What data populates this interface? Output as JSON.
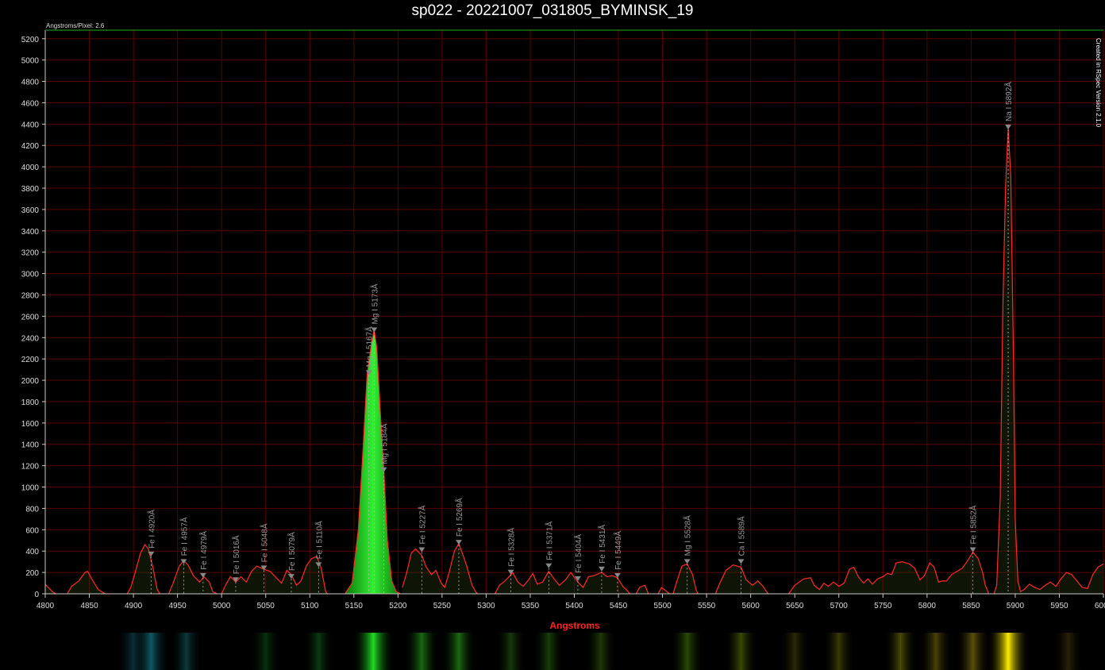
{
  "chart_data": {
    "type": "line",
    "title": "sp022 - 20221007_031805_BYMINSK_19",
    "xlabel": "Angstroms",
    "ylabel": "",
    "scale_note": "Angstroms/Pixel: 2.6",
    "credit": "Created in RSpec Version 2.1.0",
    "xlim": [
      4800,
      6000
    ],
    "ylim": [
      0,
      5280
    ],
    "x_ticks": [
      4800,
      4850,
      4900,
      4950,
      5000,
      5050,
      5100,
      5150,
      5200,
      5250,
      5300,
      5350,
      5400,
      5450,
      5500,
      5550,
      5600,
      5650,
      5700,
      5750,
      5800,
      5850,
      5900,
      5950,
      6000
    ],
    "y_ticks": [
      0,
      200,
      400,
      600,
      800,
      1000,
      1200,
      1400,
      1600,
      1800,
      2000,
      2200,
      2400,
      2600,
      2800,
      3000,
      3200,
      3400,
      3600,
      3800,
      4000,
      4200,
      4400,
      4600,
      4800,
      5000,
      5200
    ],
    "grid": true,
    "colors": {
      "line": "#ff2a2a",
      "grid": "#5a0000",
      "green_fill": "#22cc22",
      "yellow_fill": "#ffcc00",
      "marker": "#888888",
      "label": "#9a9a9a"
    },
    "series": [
      {
        "points": [
          [
            4800,
            90
          ],
          [
            4808,
            20
          ],
          [
            4812,
            -10
          ],
          [
            4825,
            -10
          ],
          [
            4830,
            70
          ],
          [
            4838,
            120
          ],
          [
            4845,
            200
          ],
          [
            4848,
            210
          ],
          [
            4852,
            150
          ],
          [
            4860,
            40
          ],
          [
            4868,
            -10
          ],
          [
            4893,
            -10
          ],
          [
            4897,
            60
          ],
          [
            4902,
            200
          ],
          [
            4908,
            380
          ],
          [
            4913,
            460
          ],
          [
            4917,
            420
          ],
          [
            4922,
            250
          ],
          [
            4927,
            40
          ],
          [
            4930,
            -10
          ],
          [
            4940,
            -10
          ],
          [
            4945,
            100
          ],
          [
            4952,
            260
          ],
          [
            4957,
            310
          ],
          [
            4962,
            270
          ],
          [
            4968,
            170
          ],
          [
            4975,
            110
          ],
          [
            4980,
            160
          ],
          [
            4986,
            110
          ],
          [
            4990,
            20
          ],
          [
            4995,
            -10
          ],
          [
            5000,
            -10
          ],
          [
            5005,
            90
          ],
          [
            5010,
            160
          ],
          [
            5016,
            110
          ],
          [
            5022,
            160
          ],
          [
            5028,
            110
          ],
          [
            5034,
            210
          ],
          [
            5040,
            260
          ],
          [
            5048,
            230
          ],
          [
            5055,
            210
          ],
          [
            5062,
            150
          ],
          [
            5068,
            100
          ],
          [
            5074,
            220
          ],
          [
            5079,
            180
          ],
          [
            5085,
            80
          ],
          [
            5090,
            120
          ],
          [
            5096,
            260
          ],
          [
            5102,
            330
          ],
          [
            5108,
            350
          ],
          [
            5113,
            240
          ],
          [
            5118,
            20
          ],
          [
            5120,
            -10
          ],
          [
            5140,
            -10
          ],
          [
            5148,
            100
          ],
          [
            5155,
            600
          ],
          [
            5160,
            1300
          ],
          [
            5165,
            2050
          ],
          [
            5170,
            2350
          ],
          [
            5173,
            2470
          ],
          [
            5176,
            2300
          ],
          [
            5180,
            1700
          ],
          [
            5184,
            1150
          ],
          [
            5188,
            500
          ],
          [
            5193,
            120
          ],
          [
            5198,
            20
          ],
          [
            5203,
            -10
          ],
          [
            5205,
            60
          ],
          [
            5210,
            200
          ],
          [
            5215,
            380
          ],
          [
            5220,
            420
          ],
          [
            5227,
            360
          ],
          [
            5232,
            250
          ],
          [
            5238,
            180
          ],
          [
            5243,
            220
          ],
          [
            5249,
            100
          ],
          [
            5253,
            60
          ],
          [
            5258,
            200
          ],
          [
            5264,
            400
          ],
          [
            5269,
            470
          ],
          [
            5273,
            380
          ],
          [
            5278,
            260
          ],
          [
            5284,
            80
          ],
          [
            5288,
            20
          ],
          [
            5290,
            -10
          ],
          [
            5310,
            -10
          ],
          [
            5315,
            80
          ],
          [
            5320,
            110
          ],
          [
            5326,
            160
          ],
          [
            5330,
            200
          ],
          [
            5336,
            110
          ],
          [
            5342,
            70
          ],
          [
            5348,
            130
          ],
          [
            5353,
            190
          ],
          [
            5358,
            90
          ],
          [
            5364,
            110
          ],
          [
            5371,
            210
          ],
          [
            5377,
            140
          ],
          [
            5383,
            80
          ],
          [
            5390,
            130
          ],
          [
            5396,
            200
          ],
          [
            5404,
            110
          ],
          [
            5410,
            60
          ],
          [
            5416,
            160
          ],
          [
            5422,
            170
          ],
          [
            5431,
            200
          ],
          [
            5437,
            160
          ],
          [
            5443,
            170
          ],
          [
            5449,
            150
          ],
          [
            5455,
            70
          ],
          [
            5460,
            30
          ],
          [
            5463,
            -10
          ],
          [
            5470,
            -10
          ],
          [
            5474,
            60
          ],
          [
            5480,
            80
          ],
          [
            5484,
            -10
          ],
          [
            5495,
            -10
          ],
          [
            5499,
            60
          ],
          [
            5505,
            20
          ],
          [
            5508,
            -10
          ],
          [
            5512,
            -10
          ],
          [
            5516,
            110
          ],
          [
            5522,
            260
          ],
          [
            5528,
            280
          ],
          [
            5534,
            180
          ],
          [
            5538,
            40
          ],
          [
            5540,
            -10
          ],
          [
            5560,
            -10
          ],
          [
            5565,
            100
          ],
          [
            5572,
            220
          ],
          [
            5580,
            270
          ],
          [
            5589,
            250
          ],
          [
            5595,
            130
          ],
          [
            5602,
            80
          ],
          [
            5608,
            120
          ],
          [
            5614,
            70
          ],
          [
            5618,
            20
          ],
          [
            5620,
            -10
          ],
          [
            5643,
            -10
          ],
          [
            5650,
            80
          ],
          [
            5660,
            140
          ],
          [
            5668,
            150
          ],
          [
            5672,
            80
          ],
          [
            5678,
            40
          ],
          [
            5683,
            100
          ],
          [
            5688,
            70
          ],
          [
            5694,
            110
          ],
          [
            5700,
            70
          ],
          [
            5706,
            100
          ],
          [
            5712,
            230
          ],
          [
            5717,
            250
          ],
          [
            5722,
            160
          ],
          [
            5728,
            100
          ],
          [
            5733,
            140
          ],
          [
            5738,
            90
          ],
          [
            5744,
            140
          ],
          [
            5750,
            160
          ],
          [
            5755,
            190
          ],
          [
            5760,
            180
          ],
          [
            5765,
            290
          ],
          [
            5772,
            300
          ],
          [
            5780,
            280
          ],
          [
            5786,
            240
          ],
          [
            5792,
            130
          ],
          [
            5797,
            170
          ],
          [
            5803,
            290
          ],
          [
            5808,
            250
          ],
          [
            5813,
            110
          ],
          [
            5817,
            120
          ],
          [
            5822,
            120
          ],
          [
            5828,
            180
          ],
          [
            5834,
            210
          ],
          [
            5840,
            240
          ],
          [
            5846,
            310
          ],
          [
            5852,
            390
          ],
          [
            5858,
            330
          ],
          [
            5863,
            200
          ],
          [
            5866,
            80
          ],
          [
            5870,
            -10
          ],
          [
            5876,
            -10
          ],
          [
            5879,
            80
          ],
          [
            5883,
            900
          ],
          [
            5886,
            2700
          ],
          [
            5889,
            3800
          ],
          [
            5892,
            4360
          ],
          [
            5895,
            3900
          ],
          [
            5898,
            2200
          ],
          [
            5900,
            700
          ],
          [
            5903,
            120
          ],
          [
            5906,
            20
          ],
          [
            5910,
            40
          ],
          [
            5916,
            90
          ],
          [
            5922,
            60
          ],
          [
            5928,
            40
          ],
          [
            5934,
            80
          ],
          [
            5940,
            110
          ],
          [
            5946,
            70
          ],
          [
            5952,
            140
          ],
          [
            5958,
            200
          ],
          [
            5964,
            180
          ],
          [
            5970,
            120
          ],
          [
            5976,
            60
          ],
          [
            5982,
            50
          ],
          [
            5988,
            180
          ],
          [
            5994,
            250
          ],
          [
            6000,
            280
          ]
        ]
      }
    ],
    "fill_bands": [
      {
        "from": 5140,
        "to": 5203,
        "color": "green"
      },
      {
        "from": 5876,
        "to": 5906,
        "color": "yellow"
      }
    ],
    "annotations": [
      {
        "x": 4920,
        "y": 350,
        "label": "Fe I 4920Å"
      },
      {
        "x": 4957,
        "y": 280,
        "label": "Fe I 4957Å"
      },
      {
        "x": 4979,
        "y": 150,
        "label": "Fe I 4979Å"
      },
      {
        "x": 5016,
        "y": 110,
        "label": "Fe I 5016Å"
      },
      {
        "x": 5048,
        "y": 220,
        "label": "Fe I 5048Å"
      },
      {
        "x": 5079,
        "y": 140,
        "label": "Fe I 5079Å"
      },
      {
        "x": 5110,
        "y": 250,
        "label": "Fe I 5110Å"
      },
      {
        "x": 5167,
        "y": 2050,
        "label": "Mg I 5167Å"
      },
      {
        "x": 5173,
        "y": 2450,
        "label": "Mg I 5173Å"
      },
      {
        "x": 5184,
        "y": 1140,
        "label": "Mg I 5184Å"
      },
      {
        "x": 5227,
        "y": 390,
        "label": "Fe I 5227Å"
      },
      {
        "x": 5269,
        "y": 460,
        "label": "Fe I 5269Å"
      },
      {
        "x": 5328,
        "y": 180,
        "label": "Fe I 5328Å"
      },
      {
        "x": 5371,
        "y": 240,
        "label": "Fe I 5371Å"
      },
      {
        "x": 5404,
        "y": 120,
        "label": "Fe I 5404Å"
      },
      {
        "x": 5431,
        "y": 210,
        "label": "Fe I 5431Å"
      },
      {
        "x": 5449,
        "y": 150,
        "label": "Fe I 5449Å"
      },
      {
        "x": 5528,
        "y": 280,
        "label": "Mg I 5528Å"
      },
      {
        "x": 5589,
        "y": 280,
        "label": "Ca I 5589Å"
      },
      {
        "x": 5852,
        "y": 390,
        "label": "Fe I 5852Å"
      },
      {
        "x": 5892,
        "y": 4350,
        "label": "Na I 5892Å"
      }
    ],
    "spectrum_strip": [
      {
        "x": 4900,
        "color": "#0c3038",
        "strength": 0.5
      },
      {
        "x": 4920,
        "color": "#0e5a66",
        "strength": 0.7
      },
      {
        "x": 4960,
        "color": "#0c3a3a",
        "strength": 0.4
      },
      {
        "x": 5050,
        "color": "#0a3010",
        "strength": 0.4
      },
      {
        "x": 5110,
        "color": "#0c3a10",
        "strength": 0.4
      },
      {
        "x": 5172,
        "color": "#22dd22",
        "strength": 1.0
      },
      {
        "x": 5227,
        "color": "#1a6a12",
        "strength": 0.6
      },
      {
        "x": 5269,
        "color": "#1d6a10",
        "strength": 0.6
      },
      {
        "x": 5328,
        "color": "#163a0a",
        "strength": 0.4
      },
      {
        "x": 5371,
        "color": "#1a400a",
        "strength": 0.4
      },
      {
        "x": 5430,
        "color": "#203a08",
        "strength": 0.4
      },
      {
        "x": 5528,
        "color": "#2a4a06",
        "strength": 0.5
      },
      {
        "x": 5589,
        "color": "#3a4a06",
        "strength": 0.5
      },
      {
        "x": 5650,
        "color": "#2a2a06",
        "strength": 0.3
      },
      {
        "x": 5700,
        "color": "#3a3a08",
        "strength": 0.4
      },
      {
        "x": 5770,
        "color": "#4a4a08",
        "strength": 0.5
      },
      {
        "x": 5810,
        "color": "#4a4208",
        "strength": 0.5
      },
      {
        "x": 5852,
        "color": "#5a500a",
        "strength": 0.6
      },
      {
        "x": 5892,
        "color": "#ffee00",
        "strength": 1.0
      },
      {
        "x": 5960,
        "color": "#2a2208",
        "strength": 0.3
      }
    ]
  }
}
